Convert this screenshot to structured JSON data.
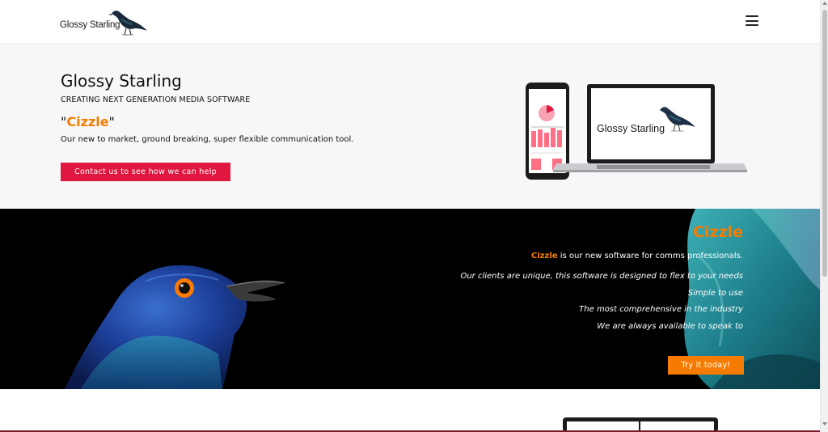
{
  "header": {
    "logo_text": "Glossy Starling",
    "menu_icon": "hamburger-menu-icon"
  },
  "hero": {
    "title": "Glossy Starling",
    "subtitle": "CREATING NEXT GENERATION MEDIA SOFTWARE",
    "product_quote_open": "\"",
    "product_name": "Cizzle",
    "product_quote_close": "\"",
    "description": "Our new to market, ground breaking, super flexible communication tool.",
    "cta_label": "Contact us to see how we can help",
    "laptop_screen_text": "Glossy Starling"
  },
  "feature": {
    "title": "Cizzle",
    "intro_brand": "Cizzle",
    "intro_rest": " is our new software for comms professionals.",
    "lines": [
      "Our clients are unique, this software is designed to flex to your needs",
      "Simple to use",
      "The most comprehensive in the industry",
      "We are always available to speak to"
    ],
    "cta_label": "Try it today!"
  },
  "colors": {
    "accent_red": "#e0173f",
    "accent_orange": "#f57c00",
    "dark_bg": "#000000",
    "hero_bg": "#f7f7f7"
  }
}
